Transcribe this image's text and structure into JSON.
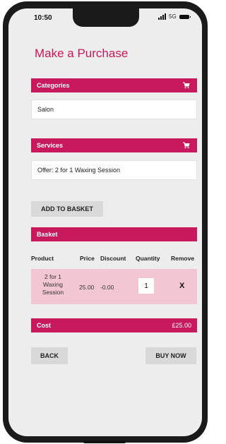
{
  "status_bar": {
    "time": "10:50",
    "network": "5G"
  },
  "page": {
    "title": "Make a Purchase"
  },
  "categories": {
    "header": "Categories",
    "value": "Salon",
    "icon": "cart-icon"
  },
  "services": {
    "header": "Services",
    "value": "Offer: 2 for 1 Waxing Session",
    "icon": "cart-icon"
  },
  "add_to_basket_label": "ADD TO BASKET",
  "basket": {
    "header": "Basket",
    "columns": [
      "Product",
      "Price",
      "Discount",
      "Quantity",
      "Remove"
    ],
    "rows": [
      {
        "product_lines": [
          "2 for 1",
          "Waxing",
          "Session"
        ],
        "price": "25.00",
        "discount": "-0.00",
        "quantity": "1",
        "remove": "X"
      }
    ]
  },
  "cost": {
    "label": "Cost",
    "value": "£25.00"
  },
  "actions": {
    "back_label": "BACK",
    "buy_now_label": "BUY NOW"
  },
  "colors": {
    "accent": "#c8195d",
    "row_background": "#f3c6d4",
    "button_background": "#d9d9d9",
    "screen_background": "#ededed"
  }
}
